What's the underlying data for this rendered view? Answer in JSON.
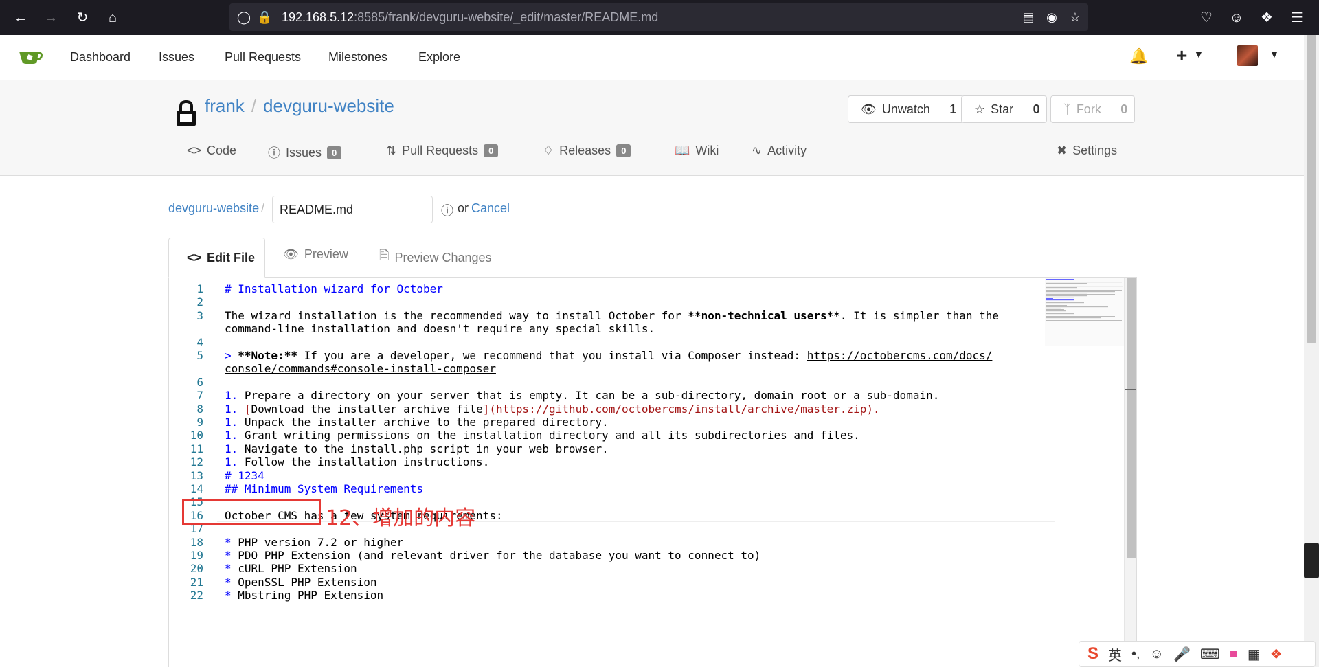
{
  "browser": {
    "url_host": "192.168.5.12",
    "url_rest": ":8585/frank/devguru-website/_edit/master/README.md",
    "icons": [
      "back-icon",
      "forward-icon",
      "reload-icon",
      "home-icon",
      "shield-icon",
      "lock-icon",
      "reader-icon",
      "fingerprint-icon",
      "star-icon",
      "pocket-icon",
      "account-icon",
      "extensions-icon",
      "menu-icon"
    ]
  },
  "navbar": {
    "items": [
      "Dashboard",
      "Issues",
      "Pull Requests",
      "Milestones",
      "Explore"
    ],
    "plus": "+"
  },
  "repo": {
    "owner": "frank",
    "sep": "/",
    "name": "devguru-website",
    "watch_label": "Unwatch",
    "watch_count": "1",
    "star_label": "Star",
    "star_count": "0",
    "fork_label": "Fork",
    "fork_count": "0",
    "tabs": {
      "code": "Code",
      "issues": "Issues",
      "issues_count": "0",
      "pulls": "Pull Requests",
      "pulls_count": "0",
      "releases": "Releases",
      "releases_count": "0",
      "wiki": "Wiki",
      "activity": "Activity",
      "settings": "Settings"
    }
  },
  "edit": {
    "breadcrumb_repo": "devguru-website",
    "breadcrumb_sep": "/",
    "filename": "README.md",
    "or": "or",
    "cancel": "Cancel",
    "tab_edit": "Edit File",
    "tab_preview": "Preview",
    "tab_changes": "Preview Changes"
  },
  "code": [
    {
      "n": "1",
      "y": 0,
      "parts": [
        {
          "t": "# Installation wizard for October",
          "c": "kw"
        }
      ]
    },
    {
      "n": "2",
      "y": 1,
      "parts": []
    },
    {
      "n": "3",
      "y": 2,
      "parts": [
        {
          "t": "The wizard installation is the recommended way to install October for "
        },
        {
          "t": "**non-technical users**",
          "c": "b"
        },
        {
          "t": ". It is simpler than the"
        }
      ]
    },
    {
      "n": "",
      "y": 3,
      "parts": [
        {
          "t": "command-line installation and doesn't require any special skills."
        }
      ]
    },
    {
      "n": "4",
      "y": 4,
      "parts": []
    },
    {
      "n": "5",
      "y": 5,
      "parts": [
        {
          "t": "> ",
          "c": "kw"
        },
        {
          "t": "**Note:**",
          "c": "b"
        },
        {
          "t": " If you are a developer, we recommend that you install via Composer instead: "
        },
        {
          "t": "https://octobercms.com/docs/",
          "c": "ul"
        }
      ]
    },
    {
      "n": "",
      "y": 6,
      "parts": [
        {
          "t": "console/commands#console-install-composer",
          "c": "ul"
        }
      ]
    },
    {
      "n": "6",
      "y": 7,
      "parts": []
    },
    {
      "n": "7",
      "y": 8,
      "parts": [
        {
          "t": "1. ",
          "c": "kw"
        },
        {
          "t": "Prepare a directory on your server that is empty. It can be a sub-directory, domain root or a sub-domain."
        }
      ]
    },
    {
      "n": "8",
      "y": 9,
      "parts": [
        {
          "t": "1. ",
          "c": "kw"
        },
        {
          "t": "[",
          "c": "lnk"
        },
        {
          "t": "Download the installer archive file"
        },
        {
          "t": "](",
          "c": "lnk"
        },
        {
          "t": "https://github.com/octobercms/install/archive/master.zip",
          "c": "lnk ul"
        },
        {
          "t": ").",
          "c": "lnk"
        }
      ]
    },
    {
      "n": "9",
      "y": 10,
      "parts": [
        {
          "t": "1. ",
          "c": "kw"
        },
        {
          "t": "Unpack the installer archive to the prepared directory."
        }
      ]
    },
    {
      "n": "10",
      "y": 11,
      "parts": [
        {
          "t": "1. ",
          "c": "kw"
        },
        {
          "t": "Grant writing permissions on the installation directory and all its subdirectories and files."
        }
      ]
    },
    {
      "n": "11",
      "y": 12,
      "parts": [
        {
          "t": "1. ",
          "c": "kw"
        },
        {
          "t": "Navigate to the install.php script in your web browser."
        }
      ]
    },
    {
      "n": "12",
      "y": 13,
      "parts": [
        {
          "t": "1. ",
          "c": "kw"
        },
        {
          "t": "Follow the installation instructions."
        }
      ]
    },
    {
      "n": "13",
      "y": 14,
      "parts": [
        {
          "t": "# 1234",
          "c": "kw"
        }
      ]
    },
    {
      "n": "14",
      "y": 15,
      "parts": [
        {
          "t": "## Minimum System Requirements",
          "c": "kw"
        }
      ]
    },
    {
      "n": "15",
      "y": 16,
      "parts": []
    },
    {
      "n": "16",
      "y": 17,
      "parts": [
        {
          "t": "October CMS has a few system requirements:"
        }
      ]
    },
    {
      "n": "17",
      "y": 18,
      "parts": []
    },
    {
      "n": "18",
      "y": 19,
      "parts": [
        {
          "t": "* ",
          "c": "kw"
        },
        {
          "t": "PHP version 7.2 or higher"
        }
      ]
    },
    {
      "n": "19",
      "y": 20,
      "parts": [
        {
          "t": "* ",
          "c": "kw"
        },
        {
          "t": "PDO PHP Extension (and relevant driver for the database you want to connect to)"
        }
      ]
    },
    {
      "n": "20",
      "y": 21,
      "parts": [
        {
          "t": "* ",
          "c": "kw"
        },
        {
          "t": "cURL PHP Extension"
        }
      ]
    },
    {
      "n": "21",
      "y": 22,
      "parts": [
        {
          "t": "* ",
          "c": "kw"
        },
        {
          "t": "OpenSSL PHP Extension"
        }
      ]
    },
    {
      "n": "22",
      "y": 23,
      "parts": [
        {
          "t": "* ",
          "c": "kw"
        },
        {
          "t": "Mbstring PHP Extension"
        }
      ]
    }
  ],
  "annotation": "12、增加的内容",
  "ime": {
    "lang": "英",
    "punct": "•,"
  },
  "colors": {
    "keyword": "#0000ff",
    "link": "#a31515",
    "line_number": "#237893",
    "brand": "#4183c4",
    "highlight": "#e53935"
  }
}
